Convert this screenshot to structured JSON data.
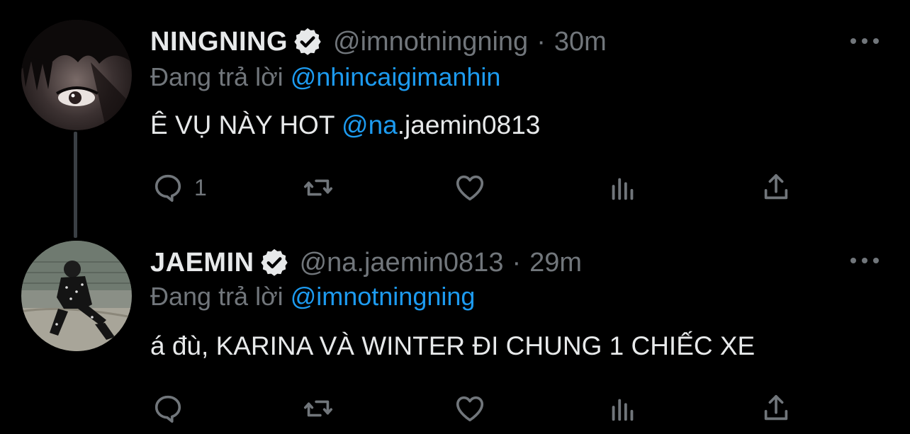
{
  "tweets": [
    {
      "display_name": "NINGNING",
      "handle": "@imnotningning",
      "separator": "·",
      "time": "30m",
      "replying_prefix": "Đang trả lời",
      "replying_to": "@nhincaigimanhin",
      "text_plain": "Ê VỤ NÀY HOT ",
      "mention_link": "@na",
      "mention_rest": ".jaemin0813",
      "reply_count": "1"
    },
    {
      "display_name": "JAEMIN",
      "handle": "@na.jaemin0813",
      "separator": "·",
      "time": "29m",
      "replying_prefix": "Đang trả lời",
      "replying_to": "@imnotningning",
      "text": "á đù, KARINA VÀ WINTER ĐI CHUNG 1 CHIẾC XE",
      "reply_count": ""
    }
  ],
  "icons": {
    "verified": "verified-badge-icon",
    "more": "more-horizontal-icon",
    "reply": "reply-bubble-icon",
    "retweet": "retweet-icon",
    "like": "heart-icon",
    "views": "bar-chart-icon",
    "share": "share-upload-icon"
  },
  "colors": {
    "background": "#000000",
    "text": "#e7e9ea",
    "secondary": "#71767b",
    "link": "#1d9bf0",
    "thread_line": "#3a3f44"
  }
}
